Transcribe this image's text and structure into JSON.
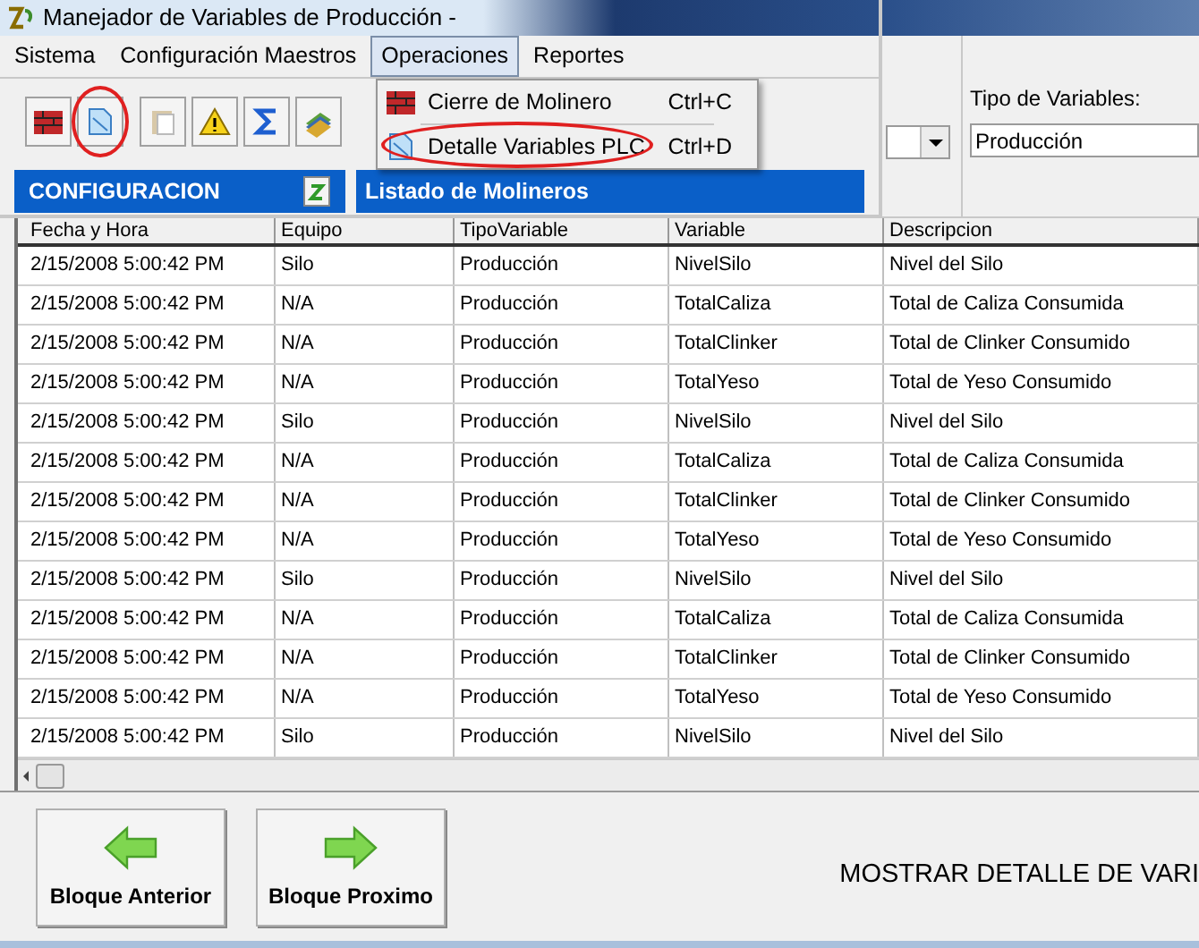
{
  "window": {
    "title": "Manejador de Variables de Producción -"
  },
  "menu": [
    {
      "label": "Sistema",
      "selected": false
    },
    {
      "label": "Configuración Maestros",
      "selected": false
    },
    {
      "label": "Operaciones",
      "selected": true
    },
    {
      "label": "Reportes",
      "selected": false
    }
  ],
  "dropdown_menu": [
    {
      "label": "Cierre de Molinero",
      "shortcut": "Ctrl+C",
      "annotated": false
    },
    {
      "label": "Detalle Variables PLC",
      "shortcut": "Ctrl+D",
      "annotated": true
    }
  ],
  "toolbar": [
    {
      "annotated": false
    },
    {
      "annotated": true
    },
    {
      "annotated": false
    },
    {
      "annotated": false
    },
    {
      "annotated": false
    },
    {
      "annotated": false
    }
  ],
  "config_panel": {
    "title": "CONFIGURACION"
  },
  "list_panel": {
    "title": "Listado de Molineros"
  },
  "filter": {
    "label": "Tipo de Variables:",
    "value": "Producción"
  },
  "table": {
    "columns": [
      "Fecha y Hora",
      "Equipo",
      "TipoVariable",
      "Variable",
      "Descripcion"
    ],
    "rows": [
      [
        "2/15/2008 5:00:42 PM",
        "Silo",
        "Producción",
        "NivelSilo",
        "Nivel del Silo"
      ],
      [
        "2/15/2008 5:00:42 PM",
        "N/A",
        "Producción",
        "TotalCaliza",
        "Total de Caliza Consumida"
      ],
      [
        "2/15/2008 5:00:42 PM",
        "N/A",
        "Producción",
        "TotalClinker",
        "Total de Clinker Consumido"
      ],
      [
        "2/15/2008 5:00:42 PM",
        "N/A",
        "Producción",
        "TotalYeso",
        "Total de Yeso Consumido"
      ],
      [
        "2/15/2008 5:00:42 PM",
        "Silo",
        "Producción",
        "NivelSilo",
        "Nivel del Silo"
      ],
      [
        "2/15/2008 5:00:42 PM",
        "N/A",
        "Producción",
        "TotalCaliza",
        "Total de Caliza Consumida"
      ],
      [
        "2/15/2008 5:00:42 PM",
        "N/A",
        "Producción",
        "TotalClinker",
        "Total de Clinker Consumido"
      ],
      [
        "2/15/2008 5:00:42 PM",
        "N/A",
        "Producción",
        "TotalYeso",
        "Total de Yeso Consumido"
      ],
      [
        "2/15/2008 5:00:42 PM",
        "Silo",
        "Producción",
        "NivelSilo",
        "Nivel del Silo"
      ],
      [
        "2/15/2008 5:00:42 PM",
        "N/A",
        "Producción",
        "TotalCaliza",
        "Total de Caliza Consumida"
      ],
      [
        "2/15/2008 5:00:42 PM",
        "N/A",
        "Producción",
        "TotalClinker",
        "Total de Clinker Consumido"
      ],
      [
        "2/15/2008 5:00:42 PM",
        "N/A",
        "Producción",
        "TotalYeso",
        "Total de Yeso Consumido"
      ],
      [
        "2/15/2008 5:00:42 PM",
        "Silo",
        "Producción",
        "NivelSilo",
        "Nivel del Silo"
      ]
    ]
  },
  "buttons": [
    {
      "label": "Bloque Anterior",
      "kind": "back"
    },
    {
      "label": "Bloque Proximo",
      "kind": "forward"
    }
  ],
  "caption": "MOSTRAR DETALLE DE VARI"
}
